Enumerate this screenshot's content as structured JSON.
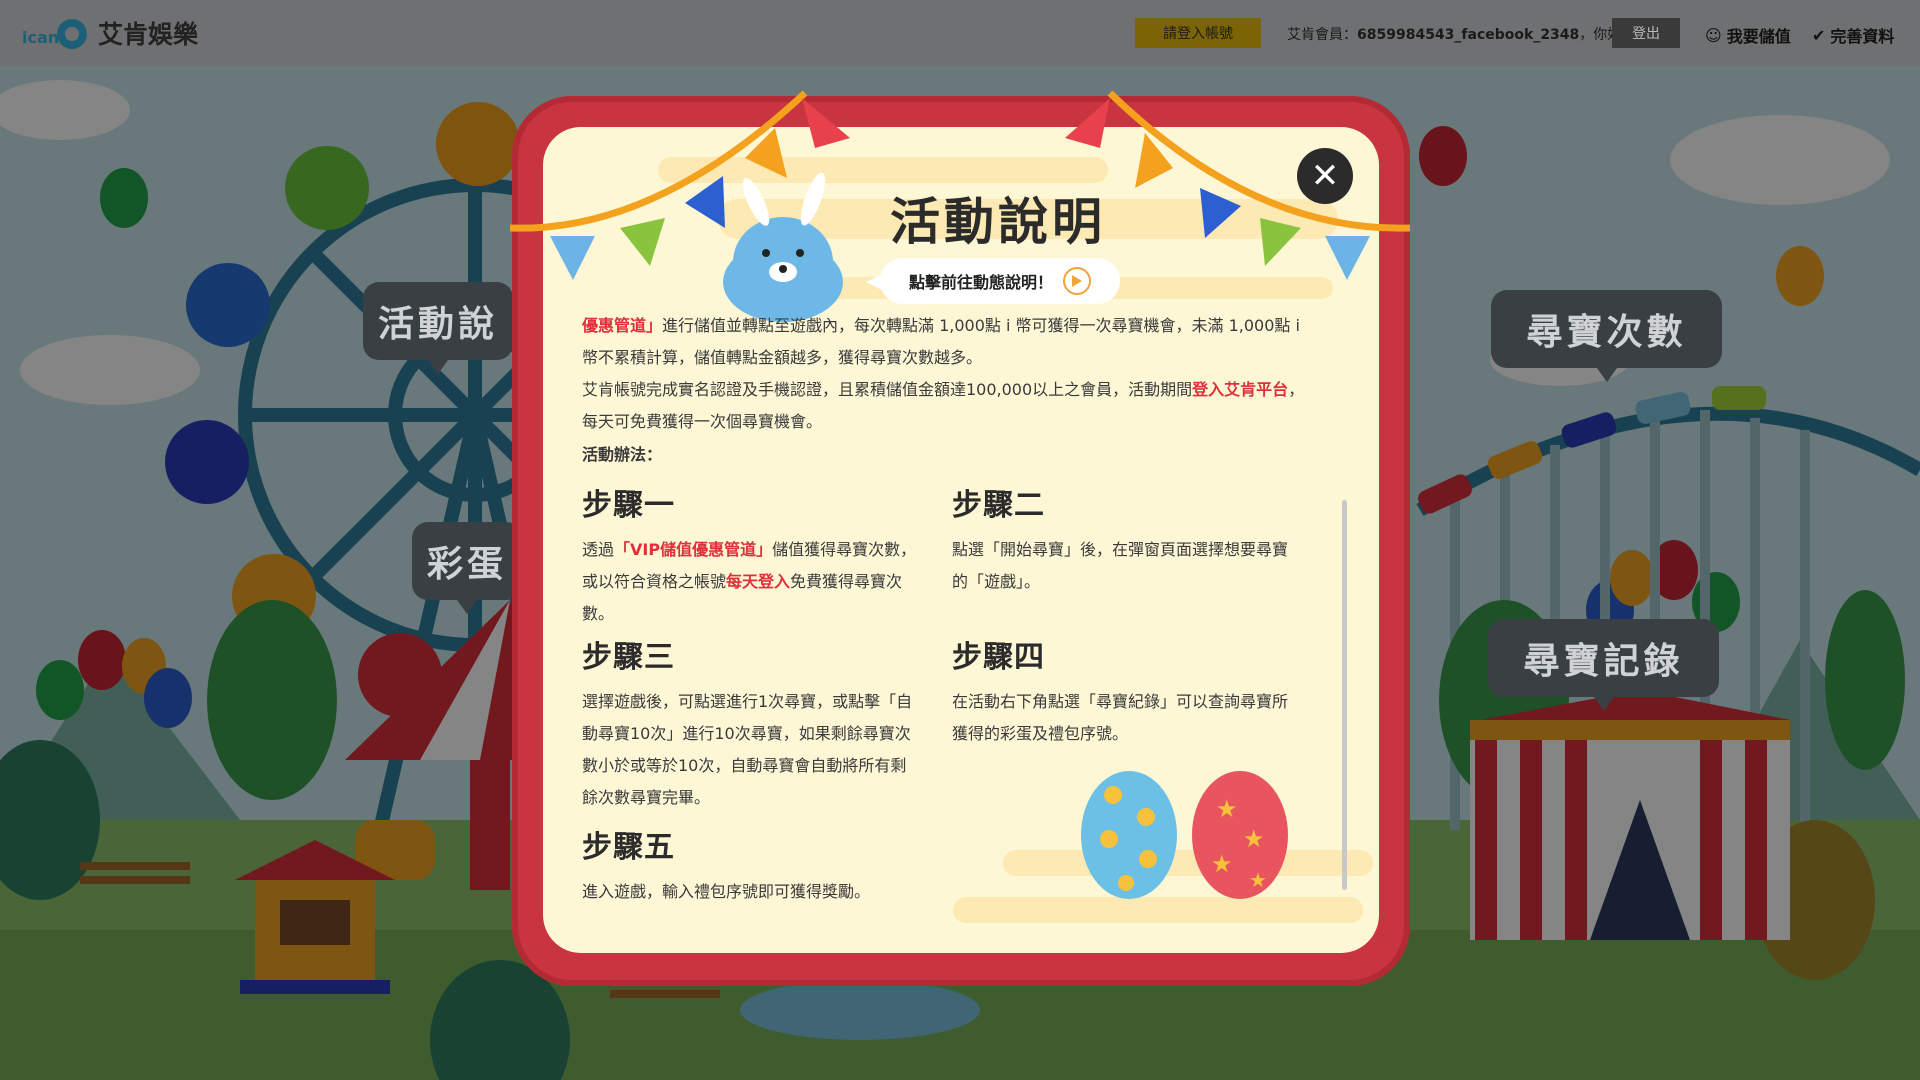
{
  "header": {
    "logo_text": "艾肯娛樂",
    "logo_mark": "ican",
    "login_label": "請登入帳號",
    "greeting_prefix": "艾肯會員：",
    "member_id": "6859984543_facebook_2348",
    "greeting_suffix": "，你好",
    "logout_label": "登出",
    "deposit_label": "我要儲值",
    "profile_label": "完善資料"
  },
  "background": {
    "bubble_left_1": "活動說",
    "bubble_left_2": "彩蛋",
    "bubble_right_1": "尋寶次數",
    "bubble_right_2": "尋寶記錄"
  },
  "modal": {
    "title": "活動說明",
    "video_label": "點擊前往動態說明！",
    "intro": {
      "p1_red": "優惠管道」",
      "p1": "進行儲值並轉點至遊戲內，每次轉點滿 1,000點 i 幣可獲得一次尋寶機會，未滿 1,000點 i 幣不累積計算，儲值轉點金額越多，獲得尋寶次數越多。",
      "p2": "艾肯帳號完成實名認證及手機認證，且累積儲值金額達100,000以上之會員，活動期間",
      "p2_red": "登入艾肯平台",
      "p2_end": "，每天可免費獲得一次個尋寶機會。"
    },
    "method_label": "活動辦法：",
    "steps": {
      "s1_title": "步驟一",
      "s1_a": "透過",
      "s1_red1": "「VIP儲值優惠管道」",
      "s1_b": "儲值獲得尋寶次數，或以符合資格之帳號",
      "s1_red2": "每天登入",
      "s1_c": "免費獲得尋寶次數。",
      "s2_title": "步驟二",
      "s2_text": "點選「開始尋寶」後，在彈窗頁面選擇想要尋寶的「遊戲」。",
      "s3_title": "步驟三",
      "s3_text": "選擇遊戲後，可點選進行1次尋寶，或點擊「自動尋寶10次」進行10次尋寶，如果剩餘尋寶次數小於或等於10次，自動尋寶會自動將所有剩餘次數尋寶完畢。",
      "s4_title": "步驟四",
      "s4_text": "在活動右下角點選「尋寶紀錄」可以查詢尋寶所獲得的彩蛋及禮包序號。",
      "s5_title": "步驟五",
      "s5_text": "進入遊戲，輸入禮包序號即可獲得獎勵。"
    }
  },
  "colors": {
    "frame_red": "#c8343f",
    "panel_cream": "#fef7d6",
    "highlight_red": "#e0303c",
    "login_gold": "#7a6406"
  }
}
